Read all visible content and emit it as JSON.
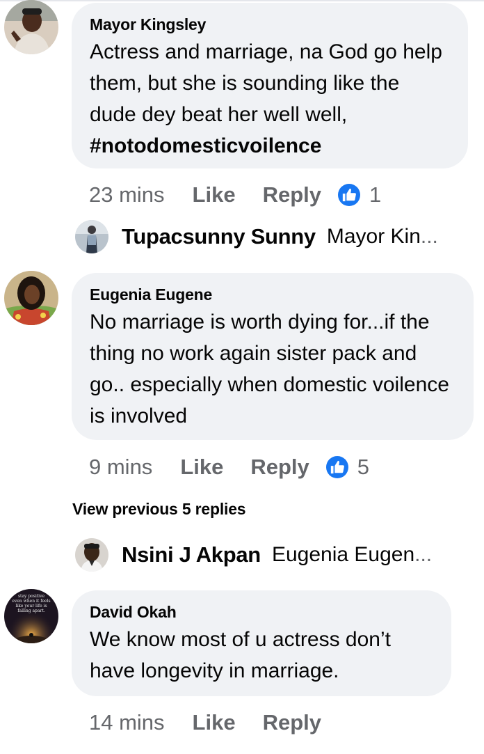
{
  "comments": [
    {
      "author": "Mayor Kingsley",
      "text": "Actress and marriage, na God go help them, but she is sounding like the dude dey beat her well well,",
      "hashtag": "#notodomesticvoilence",
      "time": "23 mins",
      "like_label": "Like",
      "reply_label": "Reply",
      "like_count": "1",
      "reply": {
        "name": "Tupacsunny Sunny",
        "snippet": "Mayor Kin",
        "ellipsis": "..."
      }
    },
    {
      "author": "Eugenia Eugene",
      "text": "No marriage is worth dying for...if the thing no work again sister pack and go.. especially when domestic voilence is involved",
      "time": "9 mins",
      "like_label": "Like",
      "reply_label": "Reply",
      "like_count": "5",
      "view_previous": "View previous 5 replies",
      "reply": {
        "name": "Nsini J Akpan",
        "snippet": "Eugenia Eugen",
        "ellipsis": "..."
      }
    },
    {
      "author": "David Okah",
      "text": "We know most of u actress don’t have longevity in marriage.",
      "time": "14 mins",
      "like_label": "Like",
      "reply_label": "Reply",
      "avatar_text": "stay positive even when it feels like your life is falling apart."
    }
  ],
  "colors": {
    "bubble": "#f0f2f5",
    "secondary_text": "#65676b",
    "like_blue": "#1877f2"
  }
}
